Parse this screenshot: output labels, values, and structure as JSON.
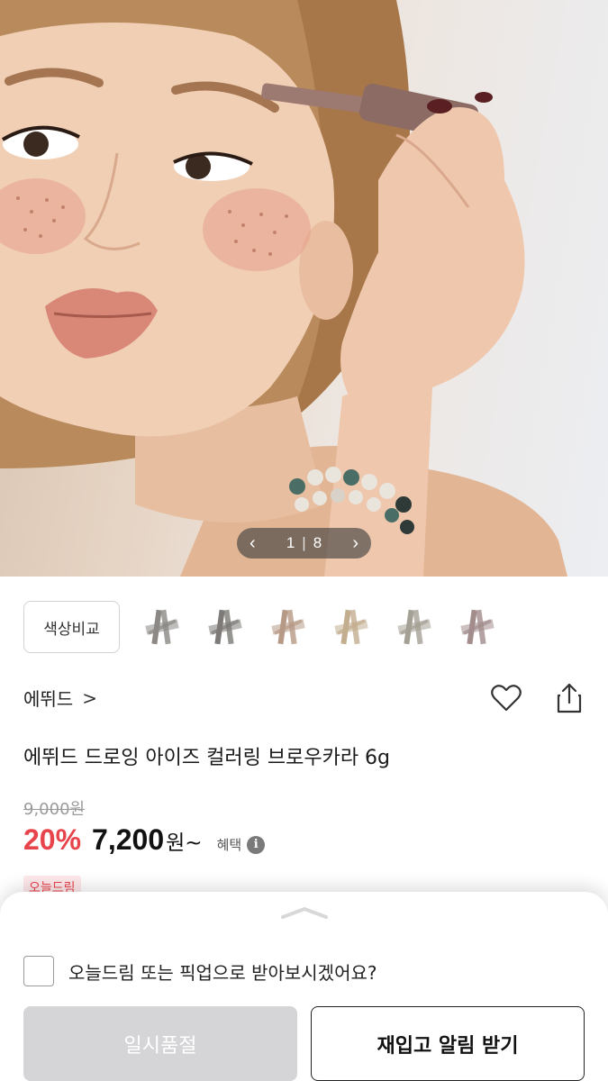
{
  "hero": {
    "image_alt": "model applying brow mascara",
    "pager": {
      "prev_icon": "chevron-left-icon",
      "current": "1",
      "separator": "|",
      "total": "8",
      "next_icon": "chevron-right-icon"
    }
  },
  "swatches": {
    "compare_label": "색상비교",
    "colors": [
      "#8b8885",
      "#7d7a77",
      "#b79a86",
      "#c3ad8f",
      "#a5a095",
      "#a28c8c"
    ]
  },
  "product": {
    "brand": "에뛰드",
    "brand_chevron": ">",
    "title": "에뛰드 드로잉 아이즈 컬러링 브로우카라 6g",
    "original_price": "9,000원",
    "discount": "20%",
    "price": "7,200",
    "currency": "원~",
    "benefit_label": "혜택",
    "info_glyph": "i",
    "badge": "오늘드림"
  },
  "sheet": {
    "pickup_question": "오늘드림 또는 픽업으로 받아보시겠어요?",
    "soldout_label": "일시품절",
    "restock_label": "재입고 알림 받기"
  },
  "colors": {
    "discount_red": "#e8444c",
    "soldout_gray": "#d5d5d7"
  }
}
